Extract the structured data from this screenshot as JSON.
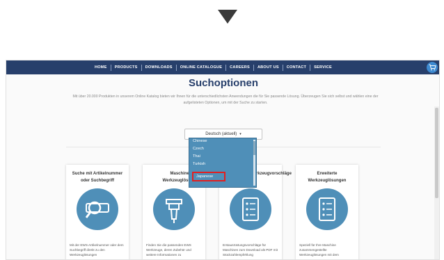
{
  "nav": {
    "items": [
      "HOME",
      "PRODUCTS",
      "DOWNLOADS",
      "ONLINE CATALOGUE",
      "CAREERS",
      "ABOUT US",
      "CONTACT",
      "SERVICE"
    ],
    "cart_icon": "shopping-cart-icon"
  },
  "page": {
    "title": "Suchoptionen",
    "intro": "Mit über 20.000 Produkten in unserem Online Katalog bieten wir Ihnen für die unterschiedlichsten Anwendungen die für Sie passende Lösung. Überzeugen Sie sich selbst und wählen eine der aufgelisteten Optionen, um mit der Suche zu starten."
  },
  "language": {
    "selected": "Deutsch (aktuell)",
    "options": [
      "Chinese",
      "Czech",
      "Thai",
      "Turkish",
      "Japanese"
    ],
    "highlighted": "Japanese"
  },
  "cards": [
    {
      "title": "Suche mit Artikelnummer oder Suchbegriff",
      "text": "Mit der EWS-Artikelnummer oder dem Suchbegriff direkt zu den Werkzeuglösungen",
      "icon": "search-number-icon"
    },
    {
      "title": "Maschinen- Werkzeuglösungen",
      "text": "Finden Sie die passenden EWS Werkzeuge, deren Zubehör und weitere Informationen zu",
      "icon": "tool-holder-icon"
    },
    {
      "title": "Werkzeugvorschläge",
      "text": "Erstausrüstungsvorschläge für Maschinen zum Download als PDF mit Stückzahlempfehlung",
      "icon": "document-list-icon"
    },
    {
      "title": "Erweiterte Werkzeuglösungen",
      "text": "Speziell für Ihre Maschine zusammengestellte Werkzeuglösungen mit dem",
      "icon": "document-list-icon"
    }
  ],
  "colors": {
    "navbar": "#273f6b",
    "accent": "#4f8fb8",
    "highlight": "#e41e1e"
  }
}
